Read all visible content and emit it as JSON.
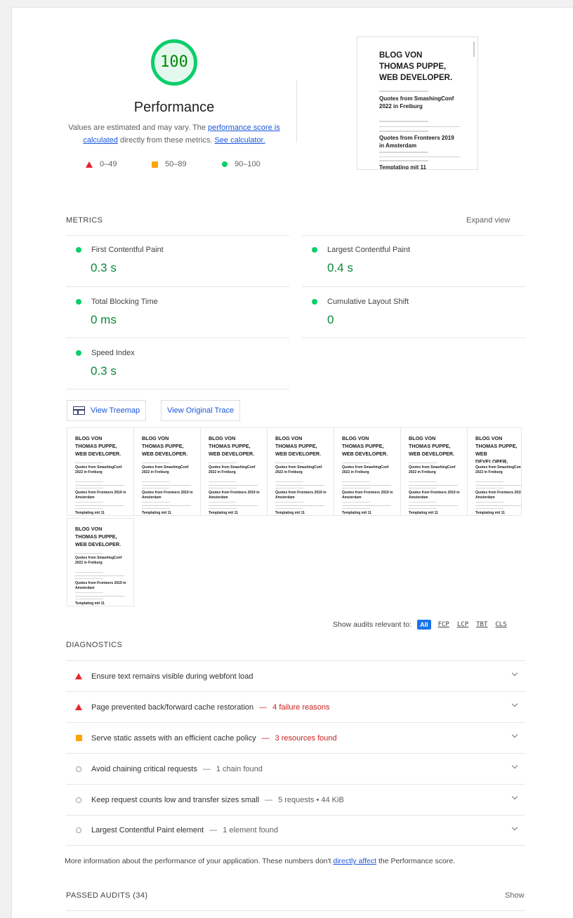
{
  "score": {
    "value": "100",
    "title": "Performance",
    "desc_prefix": "Values are estimated and may vary. The ",
    "desc_link1": "performance score is calculated",
    "desc_mid": " directly from these metrics. ",
    "desc_link2": "See calculator.",
    "legend": [
      {
        "icon": "triangle-red",
        "label": "0–49"
      },
      {
        "icon": "square-orange",
        "label": "50–89"
      },
      {
        "icon": "circle-green",
        "label": "90–100"
      }
    ],
    "color_pass": "#0cce6b"
  },
  "screenshot": {
    "blog_title_lines": [
      "BLOG VON",
      "THOMAS PUPPE,",
      "WEB DEVELOPER."
    ],
    "posts": [
      "Quotes from SmashingConf 2022 in Freiburg",
      "Quotes from Fronteers 2019 in Amsterdam",
      "Templating mit 11"
    ]
  },
  "metrics": {
    "label": "METRICS",
    "expand": "Expand view",
    "items": [
      {
        "name": "First Contentful Paint",
        "value": "0.3 s"
      },
      {
        "name": "Largest Contentful Paint",
        "value": "0.4 s"
      },
      {
        "name": "Total Blocking Time",
        "value": "0 ms"
      },
      {
        "name": "Cumulative Layout Shift",
        "value": "0"
      },
      {
        "name": "Speed Index",
        "value": "0.3 s"
      }
    ]
  },
  "buttons": {
    "treemap": "View Treemap",
    "trace": "View Original Trace"
  },
  "filter": {
    "label": "Show audits relevant to:",
    "all": "All",
    "options": [
      "FCP",
      "LCP",
      "TBT",
      "CLS"
    ]
  },
  "diagnostics": {
    "label": "DIAGNOSTICS",
    "items": [
      {
        "icon": "triangle-red",
        "title": "Ensure text remains visible during webfont load",
        "detail": "",
        "detail_color": ""
      },
      {
        "icon": "triangle-red",
        "title": "Page prevented back/forward cache restoration",
        "detail": "4 failure reasons",
        "detail_color": "red"
      },
      {
        "icon": "square-orange",
        "title": "Serve static assets with an efficient cache policy",
        "detail": "3 resources found",
        "detail_color": "red"
      },
      {
        "icon": "circle-grey",
        "title": "Avoid chaining critical requests",
        "detail": "1 chain found",
        "detail_color": "grey"
      },
      {
        "icon": "circle-grey",
        "title": "Keep request counts low and transfer sizes small",
        "detail": "5 requests • 44 KiB",
        "detail_color": "grey"
      },
      {
        "icon": "circle-grey",
        "title": "Largest Contentful Paint element",
        "detail": "1 element found",
        "detail_color": "grey"
      }
    ]
  },
  "footnote": {
    "prefix": "More information about the performance of your application. These numbers don't ",
    "link": "directly affect",
    "suffix": " the Performance score."
  },
  "passed": {
    "label": "PASSED AUDITS (34)",
    "show": "Show"
  }
}
